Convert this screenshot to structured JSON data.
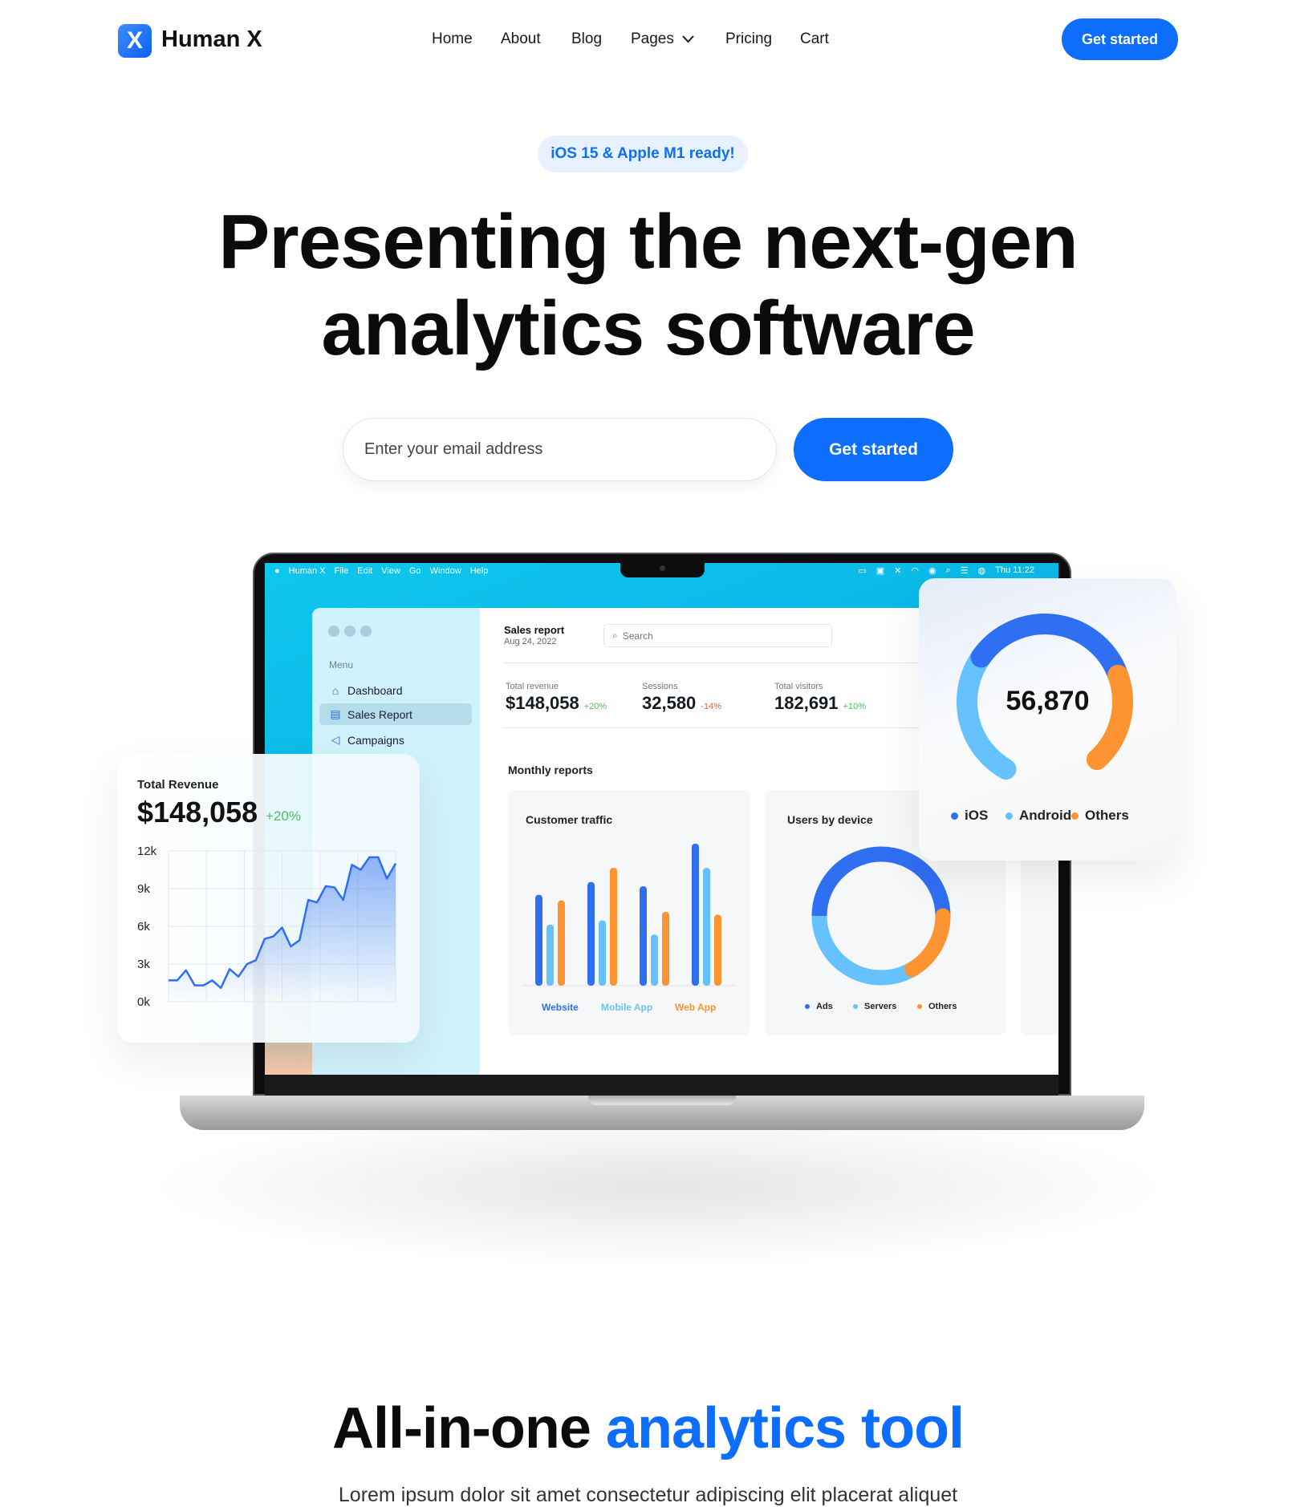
{
  "header": {
    "brand": "Human X",
    "logo_letter": "X",
    "nav": [
      "Home",
      "About",
      "Blog",
      "Pages",
      "Pricing",
      "Cart"
    ],
    "cta": "Get started"
  },
  "hero": {
    "badge": "iOS 15 & Apple M1 ready!",
    "title_line1": "Presenting the next-gen",
    "title_line2": "analytics software",
    "email_placeholder": "Enter your email address",
    "cta": "Get started"
  },
  "colors": {
    "accent": "#0d6efd",
    "blue": "#2f6ff2",
    "light_blue": "#66c2fd",
    "orange": "#fd9331",
    "green": "#4cc35c",
    "red": "#f0604a"
  },
  "macos": {
    "menu": [
      "Human X",
      "File",
      "Edit",
      "View",
      "Go",
      "Window",
      "Help"
    ],
    "clock": "Thu 11:22",
    "status_icons": [
      "airplay-icon",
      "keyboard-icon",
      "mute-icon",
      "wifi-icon",
      "user-icon",
      "search-icon",
      "control-center-icon",
      "siri-icon"
    ]
  },
  "app": {
    "sidebar": {
      "menu_label": "Menu",
      "items": [
        {
          "label": "Dashboard",
          "icon": "home-icon"
        },
        {
          "label": "Sales Report",
          "icon": "chart-icon",
          "active": true
        },
        {
          "label": "Campaigns",
          "icon": "megaphone-icon"
        }
      ]
    },
    "title": "Sales report",
    "date": "Aug 24, 2022",
    "search_placeholder": "Search",
    "stats": [
      {
        "label": "Total revenue",
        "value": "$148,058",
        "change": "+20%",
        "trend": "up"
      },
      {
        "label": "Sessions",
        "value": "32,580",
        "change": "-14%",
        "trend": "down"
      },
      {
        "label": "Total visitors",
        "value": "182,691",
        "change": "+10%",
        "trend": "up"
      }
    ],
    "monthly_title": "Monthly reports"
  },
  "revenue_card": {
    "title": "Total Revenue",
    "value": "$148,058",
    "change": "+20%"
  },
  "chart_data": [
    {
      "type": "area",
      "title": "Total Revenue",
      "yticks": [
        "12k",
        "9k",
        "6k",
        "3k",
        "0k"
      ],
      "ylim": [
        0,
        12000
      ],
      "grid": true,
      "values": [
        1700,
        1700,
        2500,
        1300,
        1300,
        1700,
        1100,
        2600,
        2000,
        3000,
        3300,
        5000,
        5200,
        5900,
        4400,
        4900,
        8100,
        7900,
        9200,
        9100,
        8100,
        10900,
        10500,
        11500,
        11500,
        9800,
        11000
      ]
    },
    {
      "type": "bar",
      "title": "Customer traffic",
      "categories": [
        "",
        "",
        "",
        ""
      ],
      "series": [
        {
          "name": "Website",
          "color": "#2f6ff2",
          "values": [
            64,
            73,
            70,
            100
          ]
        },
        {
          "name": "Mobile App",
          "color": "#66c2fd",
          "values": [
            43,
            46,
            36,
            83
          ]
        },
        {
          "name": "Web App",
          "color": "#fd9331",
          "values": [
            60,
            83,
            52,
            50
          ]
        }
      ]
    },
    {
      "type": "pie",
      "title": "Users by device",
      "donut": true,
      "labels": [
        "Ads",
        "Servers",
        "Others"
      ],
      "values": [
        50,
        33,
        17
      ],
      "colors": [
        "#2f6ff2",
        "#66c2fd",
        "#fd9331"
      ]
    },
    {
      "type": "pie",
      "donut": true,
      "center_label": "56,870",
      "labels": [
        "iOS",
        "Android",
        "Others"
      ],
      "values": [
        36,
        45,
        19
      ],
      "colors": [
        "#2f6ff2",
        "#66c2fd",
        "#fd9331"
      ]
    }
  ],
  "section2": {
    "title_dark": "All-in-one",
    "title_blue": "analytics tool",
    "text": "Lorem ipsum dolor sit amet consectetur adipiscing elit placerat aliquet"
  }
}
